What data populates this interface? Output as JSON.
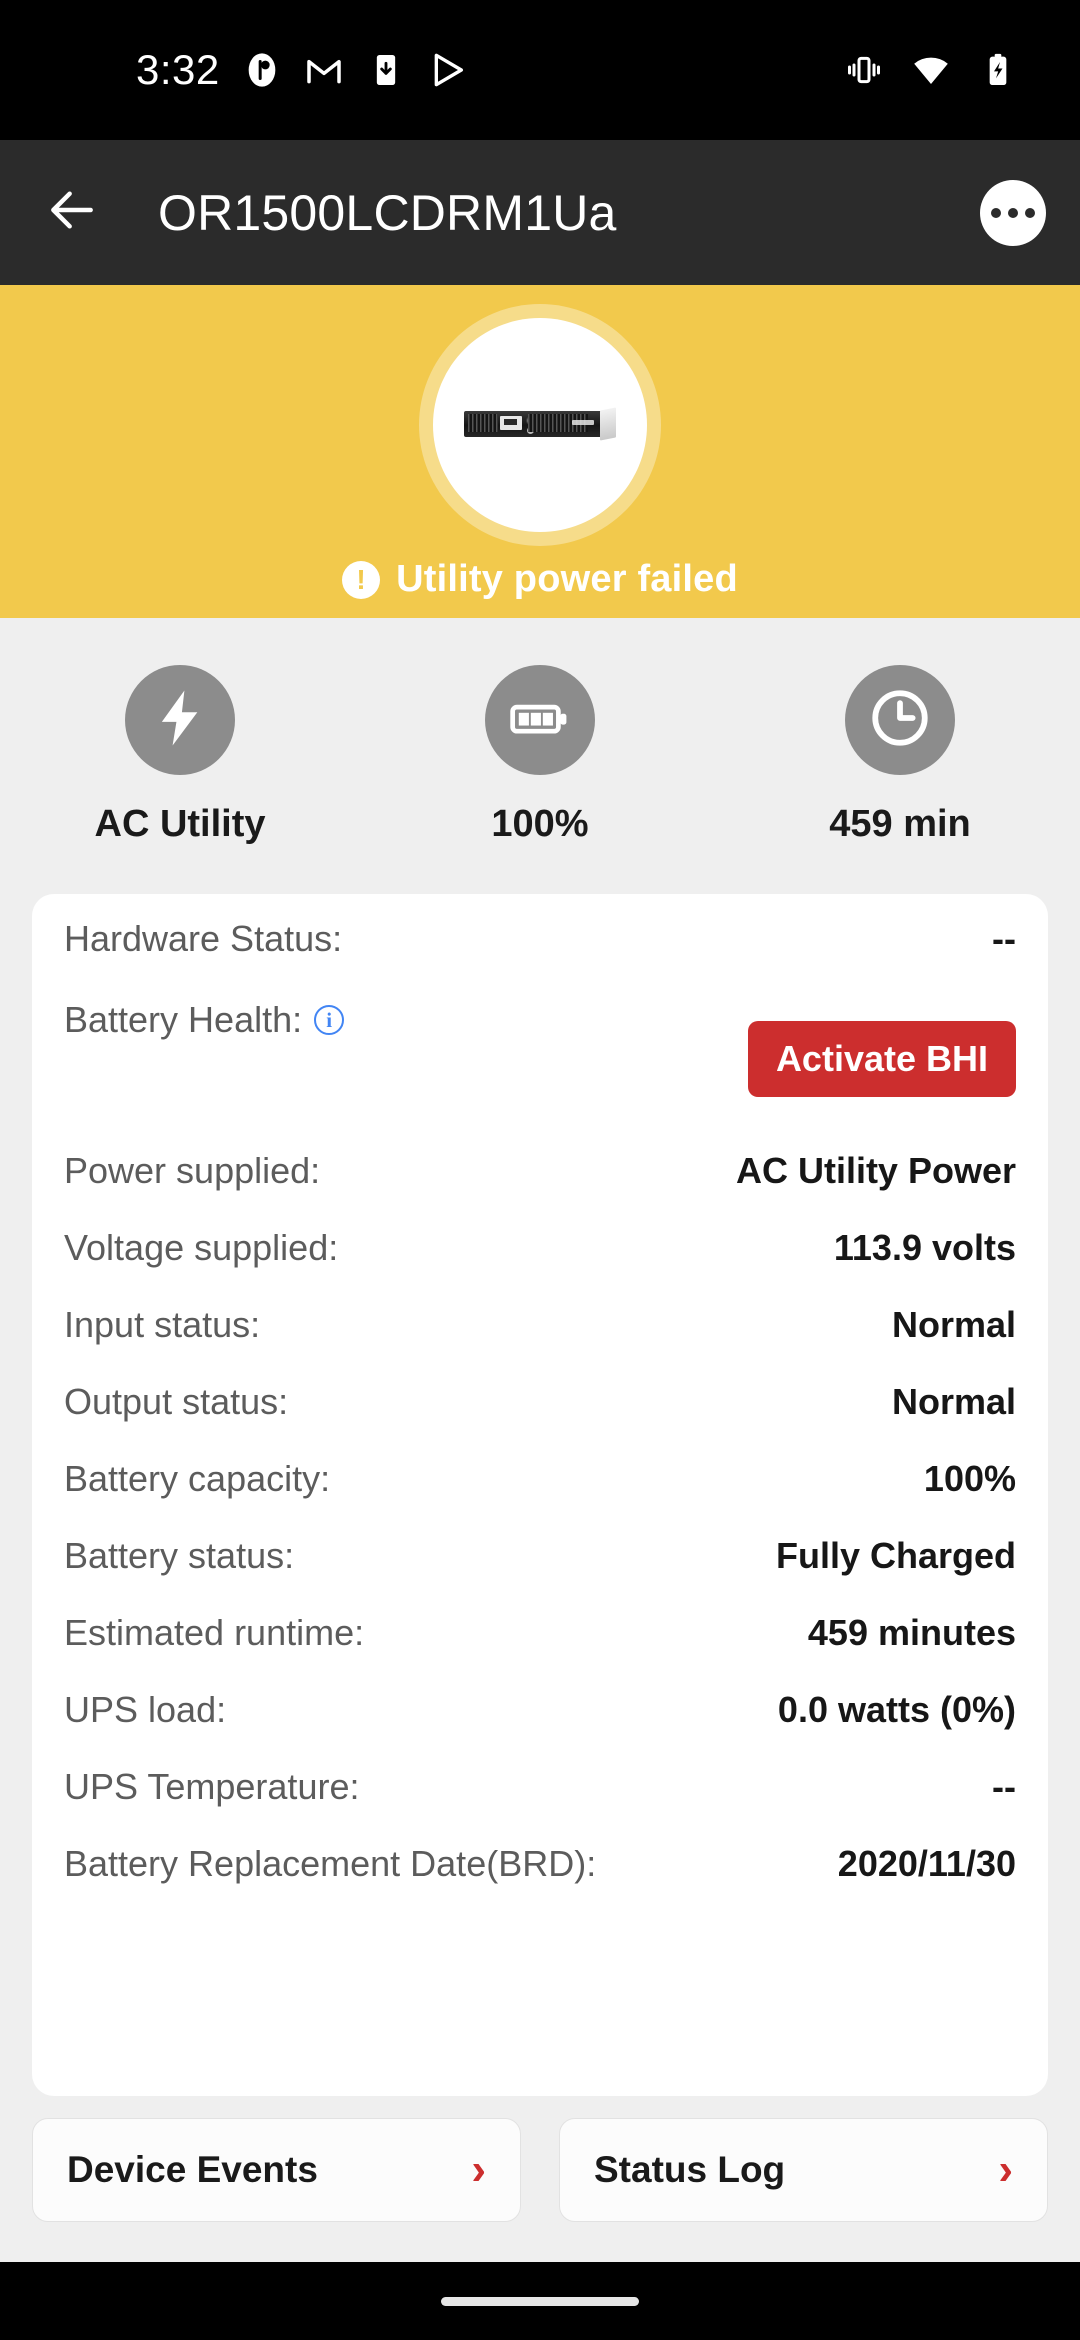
{
  "statusbar": {
    "time": "3:32",
    "left_icons": [
      "contacts-icon",
      "gmail-icon",
      "app-download-icon",
      "play-store-icon"
    ],
    "right_icons": [
      "vibrate-icon",
      "wifi-icon",
      "battery-charging-icon"
    ]
  },
  "appbar": {
    "back_icon": "back-arrow-icon",
    "title": "OR1500LCDRM1Ua",
    "overflow_icon": "overflow-menu-icon"
  },
  "hero": {
    "device_image": "ups-rackmount-device",
    "status_icon": "exclamation-circle-icon",
    "status_text": "Utility power failed",
    "background_color": "#F2C94C"
  },
  "metrics": [
    {
      "icon": "lightning-bolt-icon",
      "label": "AC Utility"
    },
    {
      "icon": "battery-full-icon",
      "label": "100%"
    },
    {
      "icon": "clock-icon",
      "label": "459 min"
    }
  ],
  "details": {
    "hardware_status": {
      "label": "Hardware Status:",
      "value": "--"
    },
    "battery_health": {
      "label": "Battery Health:",
      "info_icon": "info-icon",
      "button_label": "Activate BHI"
    },
    "rows": [
      {
        "label": "Power supplied:",
        "value": "AC Utility Power"
      },
      {
        "label": "Voltage supplied:",
        "value": "113.9 volts"
      },
      {
        "label": "Input status:",
        "value": "Normal"
      },
      {
        "label": "Output status:",
        "value": "Normal"
      },
      {
        "label": "Battery capacity:",
        "value": "100%"
      },
      {
        "label": "Battery status:",
        "value": "Fully Charged"
      },
      {
        "label": "Estimated runtime:",
        "value": "459 minutes"
      },
      {
        "label": "UPS load:",
        "value": "0.0 watts (0%)"
      },
      {
        "label": "UPS Temperature:",
        "value": "--"
      },
      {
        "label": "Battery Replacement Date(BRD):",
        "value": "2020/11/30"
      }
    ]
  },
  "bottom_actions": [
    {
      "label": "Device Events",
      "chevron": "›"
    },
    {
      "label": "Status Log",
      "chevron": "›"
    }
  ],
  "colors": {
    "accent_yellow": "#F2C94C",
    "accent_red": "#CC2E2E",
    "appbar": "#2B2B2B",
    "page_bg": "#EFEFEF",
    "info_blue": "#4285F4"
  }
}
